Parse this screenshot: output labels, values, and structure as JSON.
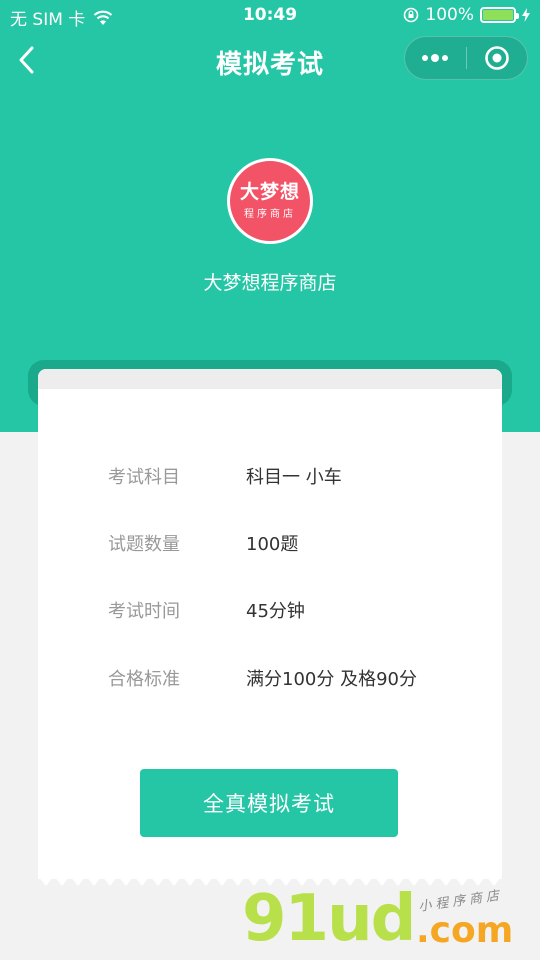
{
  "status_bar": {
    "carrier": "无 SIM 卡",
    "time": "10:49",
    "battery": "100%",
    "battery_level": 1.0
  },
  "nav": {
    "title": "模拟考试"
  },
  "shop": {
    "logo_main": "大梦想",
    "logo_sub": "程序商店",
    "name": "大梦想程序商店"
  },
  "exam_info": [
    {
      "label": "考试科目",
      "value": "科目一 小车"
    },
    {
      "label": "试题数量",
      "value": "100题"
    },
    {
      "label": "考试时间",
      "value": "45分钟"
    },
    {
      "label": "合格标准",
      "value": "满分100分 及格90分"
    }
  ],
  "start_button_label": "全真模拟考试",
  "watermark": {
    "brand": "91ud",
    "domain": ".com",
    "tagline": "小程序商店"
  },
  "colors": {
    "primary": "#24c6a5",
    "logo": "#f25366"
  }
}
